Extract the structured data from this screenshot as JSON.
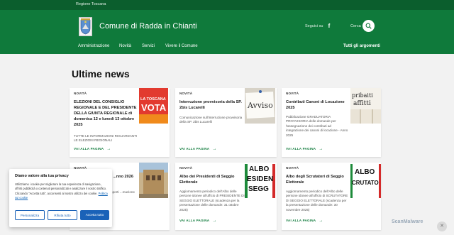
{
  "topbar": {
    "region": "Regione Toscana"
  },
  "header": {
    "site_title": "Comune di Radda in Chianti",
    "follow_label": "Seguici su",
    "search_label": "Cerca"
  },
  "nav": {
    "items": [
      "Amministrazione",
      "Novità",
      "Servizi",
      "Vivere il Comune"
    ],
    "all_topics": "Tutti gli argomenti"
  },
  "main": {
    "title": "Ultime news",
    "cards": [
      {
        "kicker": "NOVITÀ",
        "title": "ELEZIONI DEL CONSIGLIO REGIONALE E DEL PRESIDENTE DELLA GIUNTA REGIONALE di domenica 12 e lunedì 13 ottobre 2025",
        "desc": "TUTTE LE INFORMAZIONI RIGUARDANTI LE ELEZIONI REGIONALI",
        "more": "VAI ALLA PAGINA",
        "thumb_text": [
          "LA TOSCANA",
          "VOTA"
        ]
      },
      {
        "kicker": "NOVITÀ",
        "title": "Interruzione provvisoria della SP. 2bis Lucarelli",
        "desc": "Comunicazione sull'interruzione provvisoria della SP. 2bis Lucarelli",
        "more": "VAI ALLA PAGINA",
        "thumb_text": [
          "Avviso"
        ]
      },
      {
        "kicker": "NOVITÀ",
        "title": "Contributi Canoni di Locazione 2025",
        "desc": "Pubblicazione GRADUATORIA PROVVISORIA delle domande per l'assegnazione dei contributi ad integrazione dei canoni di locazione - Anno 2025",
        "more": "VAI ALLA PAGINA",
        "thumb_text": [
          "pribaiti",
          "affitti"
        ]
      },
      {
        "kicker": "NOVITÀ",
        "title": "...buti e ...nno 2026",
        "desc": "...benefici ...sporti ...mazione",
        "more": "",
        "thumb_text": []
      },
      {
        "kicker": "NOVITÀ",
        "title": "Albo dei Presidenti di Seggio Elettorale",
        "desc": "Aggiornamento periodico dell'Albo delle persone idonee all'ufficio di PRESIDENTE DI SEGGIO ELETTORALE (scadenza per la presentazione delle domande: 31 ottobre 2025)",
        "more": "VAI ALLA PAGINA",
        "thumb_text": [
          "ALBO",
          "ESIDEN",
          "SEGG"
        ]
      },
      {
        "kicker": "NOVITÀ",
        "title": "Albo degli Scrutatori di Seggio Elettorale",
        "desc": "Aggiornamento periodico dell'Albo delle persone idonee all'ufficio di SCRUTATORE DI SEGGIO ELETTORALE (scadenza per la presentazione delle domande: 30 novembre 2025)",
        "more": "VAI ALLA PAGINA",
        "thumb_text": [
          "ALBO",
          "CRUTATO"
        ]
      }
    ]
  },
  "cookie": {
    "title": "Diamo valore alla tua privacy",
    "text": "Utilizziamo i cookie per migliorare la tua esperienza di navigazione, offrirti pubblicità o contenuti personalizzati e analizzare il nostro traffico. Cliccando \"Accetta tutti\", acconsenti al nostro utilizzo dei cookie.",
    "link": "Politica sui cookie",
    "btn_customize": "Personalizza",
    "btn_reject": "Rifiuta tutto",
    "btn_accept": "Accetta tutto"
  },
  "watermark": "ScanMalware",
  "colors": {
    "header": "#0f7a3b",
    "topbar": "#0b5e2d",
    "accent": "#1a62b8"
  }
}
